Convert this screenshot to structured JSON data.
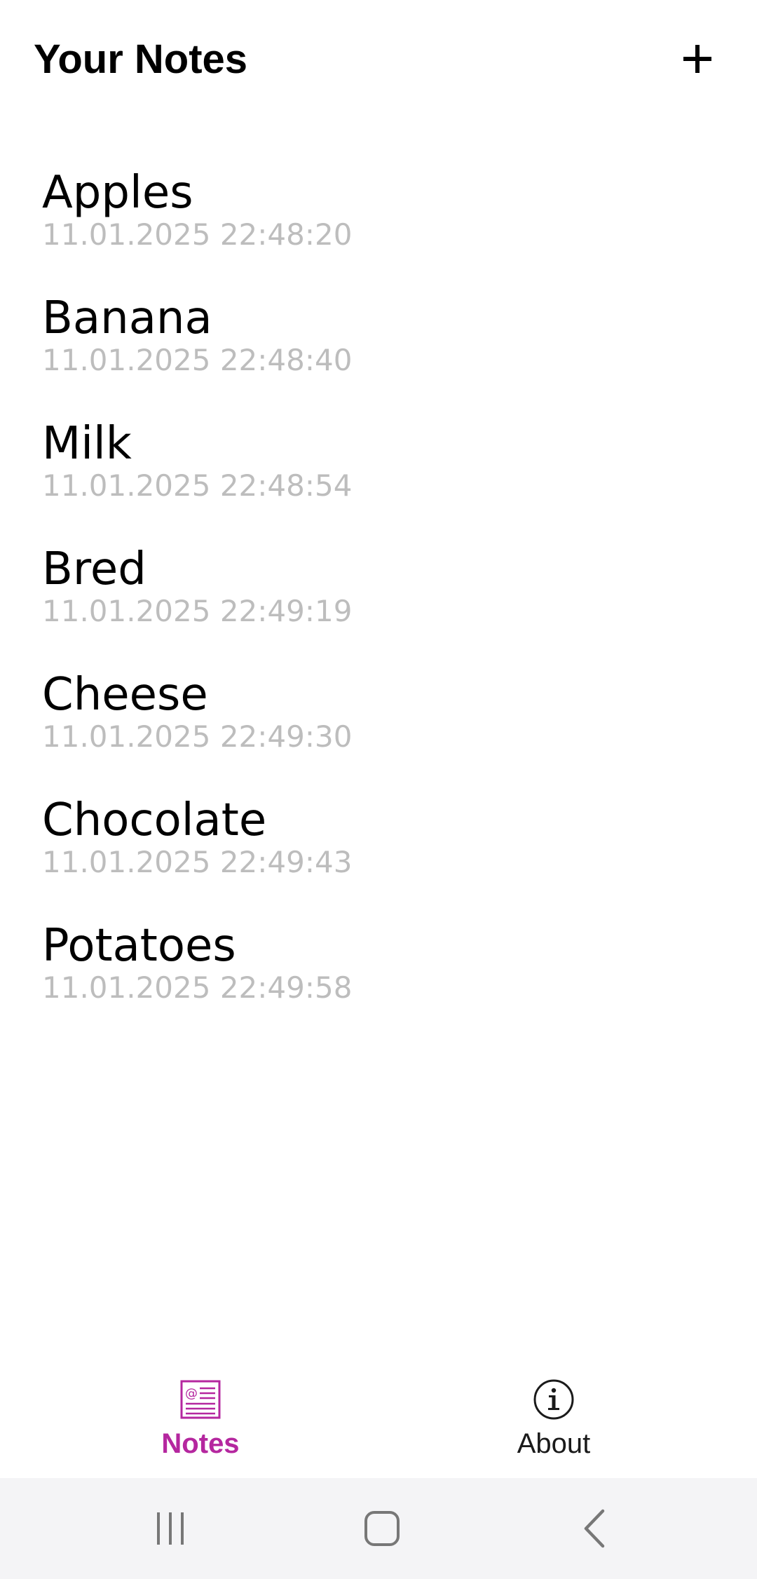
{
  "header": {
    "title": "Your Notes",
    "add_icon": "plus-icon"
  },
  "notes": [
    {
      "title": "Apples",
      "date": "11.01.2025 22:48:20"
    },
    {
      "title": "Banana",
      "date": "11.01.2025 22:48:40"
    },
    {
      "title": "Milk",
      "date": "11.01.2025 22:48:54"
    },
    {
      "title": "Bred",
      "date": "11.01.2025 22:49:19"
    },
    {
      "title": "Cheese",
      "date": "11.01.2025 22:49:30"
    },
    {
      "title": "Chocolate",
      "date": "11.01.2025 22:49:43"
    },
    {
      "title": "Potatoes",
      "date": "11.01.2025 22:49:58"
    }
  ],
  "tabs": {
    "notes": {
      "label": "Notes",
      "icon": "notes-icon",
      "active": true
    },
    "about": {
      "label": "About",
      "icon": "info-icon",
      "active": false
    }
  },
  "colors": {
    "accent": "#b5279f",
    "date_text": "#bdbdbd",
    "nav_bar": "#f4f4f6"
  },
  "system_nav": {
    "recents_icon": "recents-icon",
    "home_icon": "home-icon",
    "back_icon": "back-icon"
  }
}
